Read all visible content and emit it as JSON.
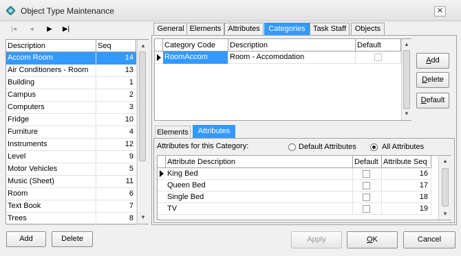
{
  "window": {
    "title": "Object Type Maintenance",
    "close_glyph": "✕"
  },
  "nav": {
    "first": "|◂",
    "prev": "◂",
    "next": "▶",
    "last": "▶|"
  },
  "left_grid": {
    "headers": [
      "Description",
      "Seq"
    ],
    "rows": [
      {
        "desc": "Accom Room",
        "seq": "14"
      },
      {
        "desc": "Air Conditioners - Room",
        "seq": "13"
      },
      {
        "desc": "Building",
        "seq": "1"
      },
      {
        "desc": "Campus",
        "seq": "2"
      },
      {
        "desc": "Computers",
        "seq": "3"
      },
      {
        "desc": "Fridge",
        "seq": "10"
      },
      {
        "desc": "Furniture",
        "seq": "4"
      },
      {
        "desc": "Instruments",
        "seq": "12"
      },
      {
        "desc": "Level",
        "seq": "9"
      },
      {
        "desc": "Motor Vehicles",
        "seq": "5"
      },
      {
        "desc": "Music (Sheet)",
        "seq": "11"
      },
      {
        "desc": "Room",
        "seq": "6"
      },
      {
        "desc": "Text Book",
        "seq": "7"
      },
      {
        "desc": "Trees",
        "seq": "8"
      }
    ]
  },
  "tabs": [
    "General",
    "Elements",
    "Attributes",
    "Categories",
    "Task Staff",
    "Objects"
  ],
  "category_grid": {
    "headers": [
      "Category Code",
      "Description",
      "Default"
    ],
    "rows": [
      {
        "code": "RoomAccom",
        "desc": "Room - Accomodation"
      }
    ]
  },
  "side_buttons": {
    "add_u": "A",
    "add_rest": "dd",
    "delete_u": "D",
    "delete_rest": "elete",
    "default_u": "D",
    "default_rest": "efault"
  },
  "subtabs": [
    "Elements",
    "Attributes"
  ],
  "attributes_label": "Attributes for this Category:",
  "radios": {
    "default_attrs": "Default Attributes",
    "all_attrs": "All Attributes"
  },
  "attr_grid": {
    "headers": [
      "Attribute Description",
      "Default",
      "Attribute Seq"
    ],
    "rows": [
      {
        "desc": "King Bed",
        "seq": "16"
      },
      {
        "desc": "Queen Bed",
        "seq": "17"
      },
      {
        "desc": "Single Bed",
        "seq": "18"
      },
      {
        "desc": "TV",
        "seq": "19"
      }
    ]
  },
  "bottom": {
    "add": "Add",
    "delete": "Delete",
    "apply": "Apply",
    "ok_u": "O",
    "ok_rest": "K",
    "cancel": "Cancel"
  },
  "colors": {
    "selection": "#3399ff",
    "window_bg": "#f0f0f0"
  }
}
